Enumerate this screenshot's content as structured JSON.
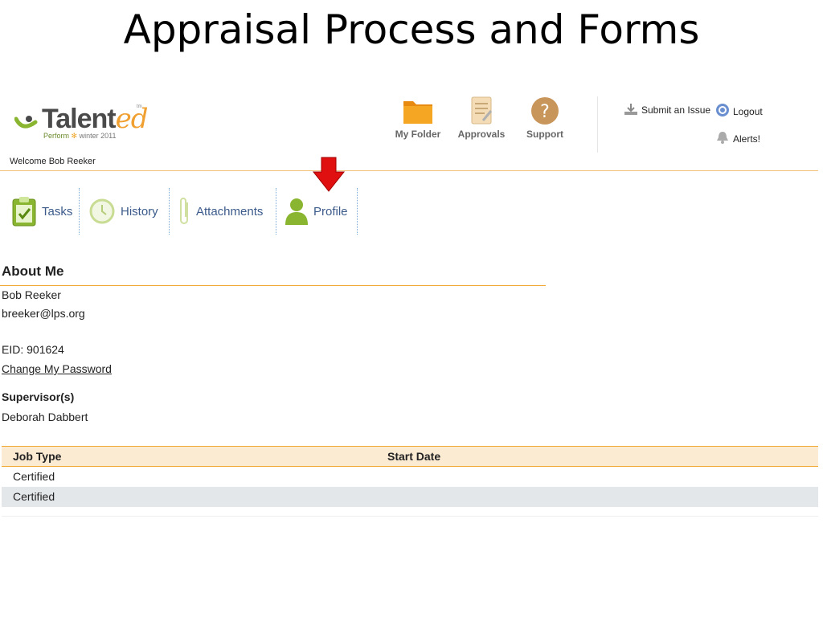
{
  "slide": {
    "title": "Appraisal Process and Forms"
  },
  "app": {
    "logo_text": "Talent",
    "logo_text_accent": "ed",
    "logo_trademark": "tm",
    "logo_product": "Perform",
    "logo_edition": "winter 2011",
    "welcome": "Welcome Bob Reeker"
  },
  "toolbar": {
    "items": [
      {
        "label": "My Folder",
        "icon": "folder-icon"
      },
      {
        "label": "Approvals",
        "icon": "approvals-icon"
      },
      {
        "label": "Support",
        "icon": "support-icon"
      }
    ],
    "submit_issue": "Submit an Issue",
    "logout": "Logout",
    "alerts": "Alerts!"
  },
  "tabs": [
    {
      "label": "Tasks",
      "icon": "clipboard-check-icon"
    },
    {
      "label": "History",
      "icon": "clock-icon"
    },
    {
      "label": "Attachments",
      "icon": "paperclip-icon"
    },
    {
      "label": "Profile",
      "icon": "person-icon"
    }
  ],
  "profile": {
    "section_title": "About Me",
    "name": "Bob Reeker",
    "email": "breeker@lps.org",
    "eid": "EID: 901624",
    "change_password": "Change My Password",
    "supervisors_title": "Supervisor(s)",
    "supervisor": "Deborah Dabbert"
  },
  "jobs": {
    "columns": [
      "Job Type",
      "Start Date"
    ],
    "rows": [
      {
        "job_type": "Certified",
        "start_date": ""
      },
      {
        "job_type": "Certified",
        "start_date": ""
      }
    ]
  },
  "colors": {
    "accent_orange": "#f0a830",
    "tab_text": "#3b5a8a",
    "pointer_arrow": "#e01010"
  }
}
